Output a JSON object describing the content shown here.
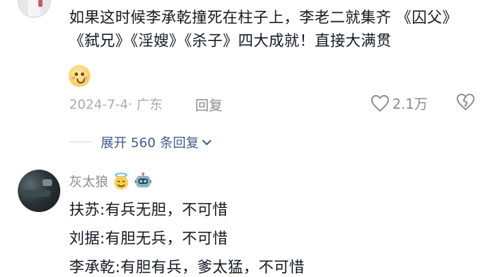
{
  "top_comment": {
    "text": "如果这时候李承乾撞死在柱子上，李老二就集齐 《囚父》《弑兄》《淫嫂》《杀子》四大成就！直接大满贯",
    "emoji": "blushing-face-emoji",
    "date_location": "2024-7-4· 广东",
    "reply_label": "回复",
    "like_count": "2.1万"
  },
  "expand_replies": {
    "label": "展开 560 条回复"
  },
  "reply_comment": {
    "username": "灰太狼",
    "badges": [
      "halo-smile-emoji",
      "robot-emoji"
    ],
    "lines": [
      "扶苏:有兵无胆，不可惜",
      "刘据:有胆无兵，不可惜",
      "李承乾:有胆有兵，爹太猛，不可惜"
    ]
  },
  "colors": {
    "text": "#161823",
    "meta": "#a9aab0",
    "link": "#3f5e93"
  }
}
